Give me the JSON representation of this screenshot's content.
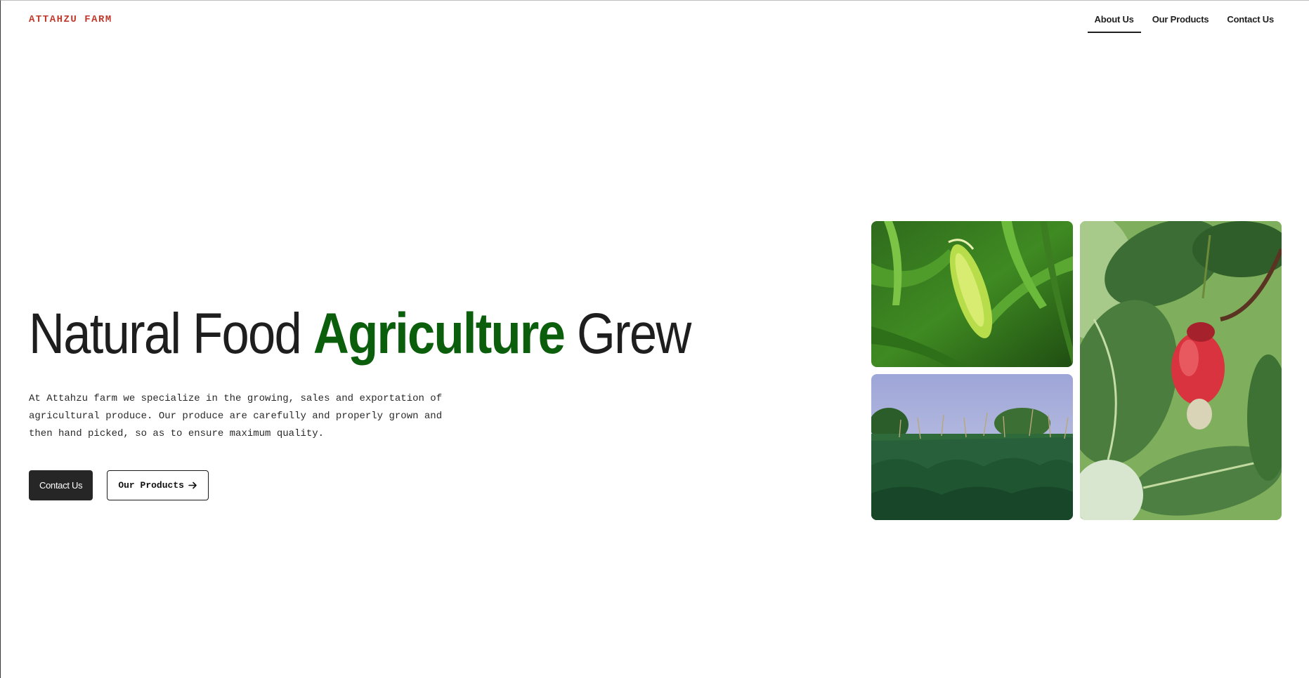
{
  "header": {
    "brand": "ATTAHZU FARM",
    "nav": [
      {
        "label": "About Us",
        "active": true
      },
      {
        "label": "Our Products",
        "active": false
      },
      {
        "label": "Contact Us",
        "active": false
      }
    ]
  },
  "hero": {
    "title_part1": "Natural Food ",
    "title_accent": "Agriculture",
    "title_part3": " Grew",
    "description": "At Attahzu farm we specialize in the growing, sales and exportation of agricultural produce. Our produce are carefully and properly grown and then hand picked, so as to ensure maximum quality.",
    "primary_button": "Contact Us",
    "secondary_button": "Our Products",
    "secondary_icon": "arrow-right-icon"
  },
  "colors": {
    "brand": "#c0392b",
    "accent": "#0b5e0b",
    "button_dark": "#262626"
  },
  "images": [
    {
      "name": "corn-ear-photo"
    },
    {
      "name": "corn-field-photo"
    },
    {
      "name": "cashew-fruit-photo"
    }
  ]
}
